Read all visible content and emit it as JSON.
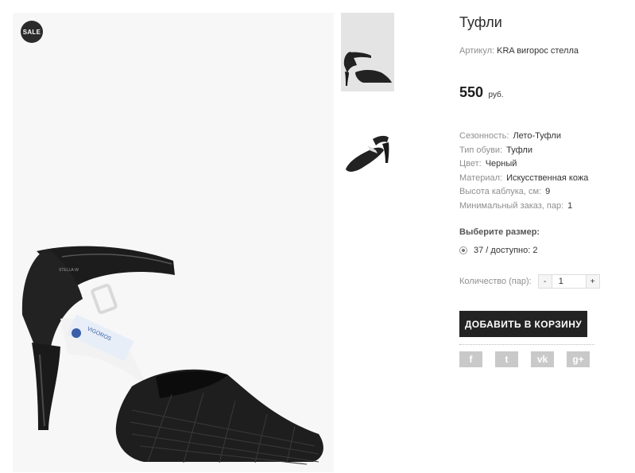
{
  "main_image": {
    "badge": "SALE",
    "shoe_label_text": "STELLA-W",
    "insole_text": "VIGOROS"
  },
  "product": {
    "title": "Туфли",
    "sku_label": "Артикул:",
    "sku_value": "KRA вигорос стелла",
    "price_value": "550",
    "price_currency": "руб."
  },
  "properties": [
    {
      "label": "Сезонность:",
      "value": "Лето-Туфли"
    },
    {
      "label": "Тип обуви:",
      "value": "Туфли"
    },
    {
      "label": "Цвет:",
      "value": "Черный"
    },
    {
      "label": "Материал:",
      "value": "Искусственная кожа"
    },
    {
      "label": "Высота каблука, см:",
      "value": "9"
    },
    {
      "label": "Минимальный заказ, пар:",
      "value": "1"
    }
  ],
  "size": {
    "heading": "Выберите размер:",
    "option": "37 / доступно: 2"
  },
  "quantity": {
    "label": "Количество (пар):",
    "minus": "-",
    "value": "1",
    "plus": "+"
  },
  "cart": {
    "add_label": "ДОБАВИТЬ В КОРЗИНУ"
  },
  "social": [
    "facebook-icon",
    "twitter-icon",
    "vk-icon",
    "google-plus-icon"
  ],
  "social_glyphs": [
    "f",
    "t",
    "vk",
    "g+"
  ],
  "colors": {
    "button_bg": "#232323",
    "badge_bg": "#2b2b2b",
    "social_bg": "#c9c9c9"
  }
}
